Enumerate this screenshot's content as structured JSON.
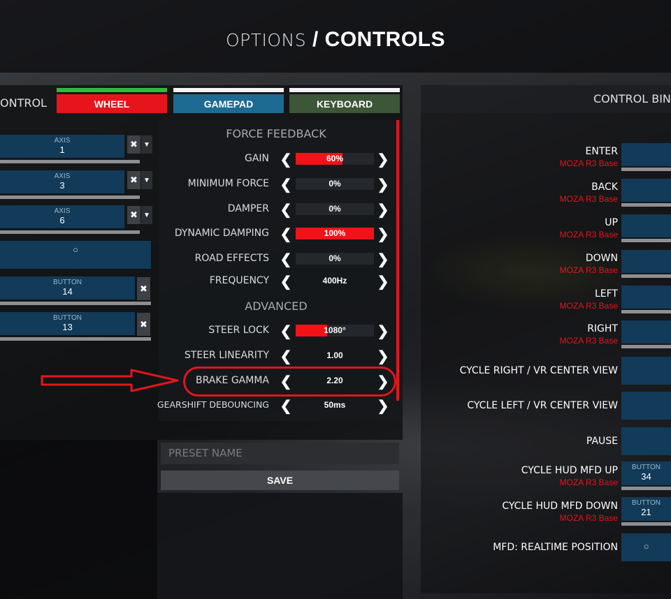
{
  "title": {
    "light": "OPTIONS",
    "slash": "/",
    "bold": "CONTROLS"
  },
  "left": {
    "heading": "ONTROL",
    "tabs": {
      "wheel": "WHEEL",
      "gamepad": "GAMEPAD",
      "keyboard": "KEYBOARD"
    },
    "binds": [
      {
        "type": "AXIS",
        "value": "1"
      },
      {
        "type": "AXIS",
        "value": "3"
      },
      {
        "type": "AXIS",
        "value": "6"
      },
      {
        "type": "",
        "value": "○"
      },
      {
        "type": "BUTTON",
        "value": "14"
      },
      {
        "type": "BUTTON",
        "value": "13"
      }
    ],
    "clear_glyph": "✖",
    "dropdown_glyph": "▼"
  },
  "ffb": {
    "section_force_feedback": "FORCE FEEDBACK",
    "section_advanced": "ADVANCED",
    "arrow_left": "❮",
    "arrow_right": "❯",
    "rows": [
      {
        "label": "GAIN",
        "value": "60%",
        "level": 0.6
      },
      {
        "label": "MINIMUM FORCE",
        "value": "0%",
        "level": 0
      },
      {
        "label": "DAMPER",
        "value": "0%",
        "level": 0
      },
      {
        "label": "DYNAMIC DAMPING",
        "value": "100%",
        "level": 1.0
      },
      {
        "label": "ROAD EFFECTS",
        "value": "0%",
        "level": 0
      },
      {
        "label": "FREQUENCY",
        "value": "400Hz"
      },
      {
        "label": "STEER LOCK",
        "value": "1080°",
        "level": 0.4
      },
      {
        "label": "STEER LINEARITY",
        "value": "1.00"
      },
      {
        "label": "BRAKE GAMMA",
        "value": "2.20"
      },
      {
        "label": "GEARSHIFT DEBOUNCING",
        "value": "50ms"
      }
    ]
  },
  "preset": {
    "placeholder": "PRESET NAME",
    "save": "SAVE"
  },
  "right": {
    "title": "CONTROL BIND",
    "binds": [
      {
        "name": "ENTER",
        "device": "MOZA R3 Base"
      },
      {
        "name": "BACK",
        "device": "MOZA R3 Base"
      },
      {
        "name": "UP",
        "device": "MOZA R3 Base"
      },
      {
        "name": "DOWN",
        "device": "MOZA R3 Base"
      },
      {
        "name": "LEFT",
        "device": "MOZA R3 Base"
      },
      {
        "name": "RIGHT",
        "device": "MOZA R3 Base"
      },
      {
        "name": "CYCLE RIGHT / VR CENTER VIEW"
      },
      {
        "name": "CYCLE LEFT / VR CENTER VIEW"
      },
      {
        "name": "PAUSE"
      },
      {
        "name": "CYCLE HUD MFD UP",
        "device": "MOZA R3 Base",
        "type": "BUTTON",
        "value": "34"
      },
      {
        "name": "CYCLE HUD MFD DOWN",
        "device": "MOZA R3 Base",
        "type": "BUTTON",
        "value": "21"
      },
      {
        "name": "MFD: REALTIME POSITION",
        "value": "○"
      }
    ]
  },
  "colors": {
    "accent_red": "#e3151b",
    "bind_blue": "#123a59",
    "wheel_tab": "#e8141b",
    "gamepad_tab": "#1d6a92",
    "keyboard_tab": "#3c5637"
  }
}
